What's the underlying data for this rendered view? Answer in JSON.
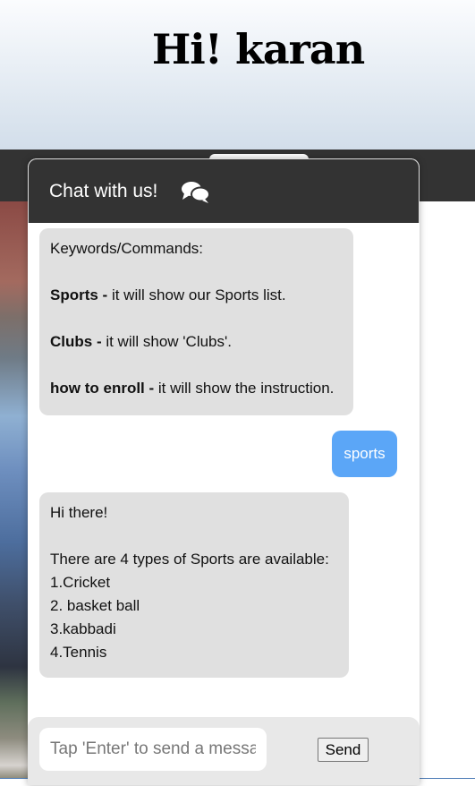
{
  "hero": {
    "greeting": "Hi! karan"
  },
  "chat": {
    "title": "Chat with us!",
    "icon": "chat-bubbles-icon",
    "messages": [
      {
        "from": "bot",
        "intro": "Keywords/Commands:",
        "commands": [
          {
            "keyword": "Sports -",
            "text": " it will show our Sports list."
          },
          {
            "keyword": "Clubs -",
            "text": " it will show 'Clubs'."
          },
          {
            "keyword": "how to enroll -",
            "text": " it will show the instruction."
          }
        ]
      },
      {
        "from": "user",
        "text": "sports"
      },
      {
        "from": "bot",
        "greeting": "Hi there!",
        "intro": "There are 4 types of Sports are available:",
        "items": [
          "1.Cricket",
          "2. basket ball",
          "3.kabbadi",
          "4.Tennis"
        ]
      }
    ],
    "input_placeholder": "Tap 'Enter' to send a message",
    "send_label": "Send"
  },
  "colors": {
    "header": "#333333",
    "user_bubble": "#5ba6f7",
    "bot_bubble": "#e0e0e0"
  }
}
